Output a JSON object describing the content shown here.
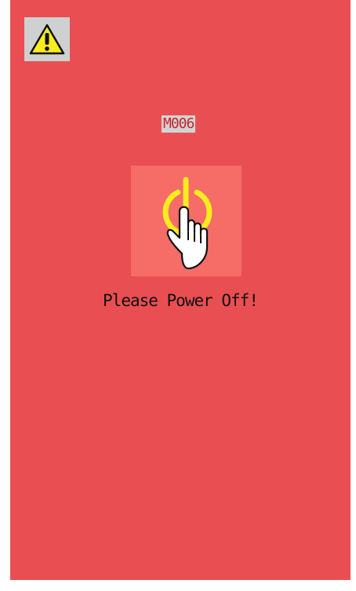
{
  "alert": {
    "code": "M006",
    "message": "Please Power Off!"
  },
  "colors": {
    "background": "#e94f52",
    "tile": "#f66c67",
    "power_symbol": "#f7ec1e",
    "warning_box": "#cfd0d0",
    "code_text": "#c2262d"
  },
  "icons": {
    "warning": "warning-triangle-icon",
    "power": "power-button-icon",
    "hand": "pointing-hand-icon"
  }
}
